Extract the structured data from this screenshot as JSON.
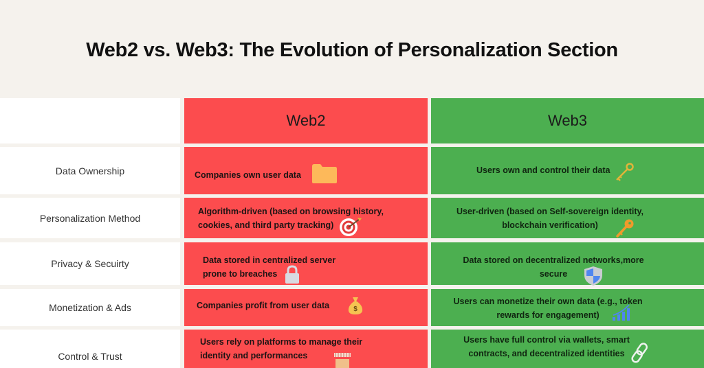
{
  "title": "Web2 vs. Web3: The Evolution of Personalization Section",
  "columns": {
    "web2": "Web2",
    "web3": "Web3"
  },
  "colors": {
    "web2": "#fc4c4e",
    "web3": "#4caf50",
    "background": "#f5f2ed",
    "label_bg": "#ffffff"
  },
  "rows": [
    {
      "label": "Data Ownership",
      "web2": [
        "Companies own user data"
      ],
      "web2_icon": "folder-icon",
      "web3": [
        "Users own and control their data"
      ],
      "web3_icon": "key-icon"
    },
    {
      "label": "Personalization Method",
      "web2": [
        "Algorithm-driven (based on browsing history,",
        "cookies, and third party tracking)"
      ],
      "web2_icon": "target-icon",
      "web3": [
        "User-driven (based on Self-sovereign identity,",
        "blockchain verification)"
      ],
      "web3_icon": "key-icon"
    },
    {
      "label": "Privacy & Secuirty",
      "web2": [
        "Data  stored in centralized server",
        "prone to breaches"
      ],
      "web2_icon": "lock-icon",
      "web3": [
        "Data stored on decentralized networks,more",
        "secure"
      ],
      "web3_icon": "shield-icon"
    },
    {
      "label": "Monetization & Ads",
      "web2": [
        "Companies profit from user data"
      ],
      "web2_icon": "money-bag-icon",
      "web3": [
        "Users can monetize their own data (e.g., token",
        "rewards for engagement)"
      ],
      "web3_icon": "bar-chart-icon"
    },
    {
      "label": "Control & Trust",
      "web2": [
        "Users rely on platforms to manage  their",
        "identity  and  performances"
      ],
      "web2_icon": "storefront-icon",
      "web3": [
        "Users have full control via wallets, smart",
        "contracts, and  decentralized  identities"
      ],
      "web3_icon": "link-icon"
    }
  ]
}
